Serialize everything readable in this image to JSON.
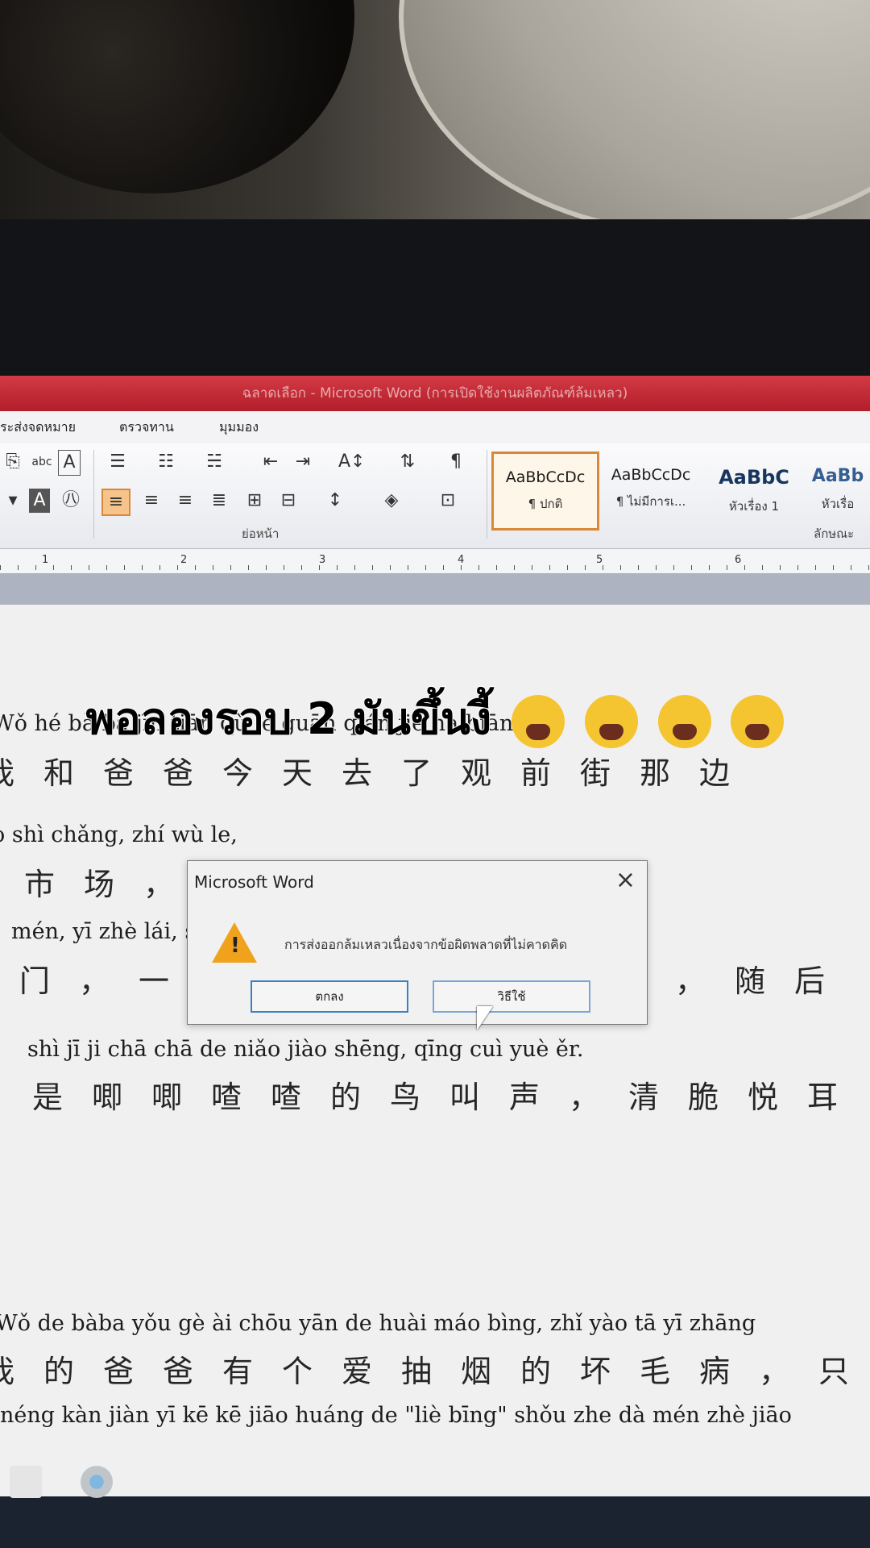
{
  "window": {
    "title": "ฉลาดเลือก - Microsoft Word (การเปิดใช้งานผลิตภัณฑ์ล้มเหลว)"
  },
  "ribbon": {
    "tabs": [
      "ระส่งจดหมาย",
      "ตรวจทาน",
      "มุมมอง"
    ],
    "group_paragraph": "ย่อหน้า",
    "group_styles": "ลักษณะ",
    "styles": [
      {
        "sample": "AaBbCcDc",
        "name": "¶ ปกติ"
      },
      {
        "sample": "AaBbCcDc",
        "name": "¶ ไม่มีการเ..."
      },
      {
        "sample": "AaBbC",
        "name": "หัวเรื่อง 1"
      },
      {
        "sample": "AaBb",
        "name": "หัวเรื่อ"
      }
    ]
  },
  "ruler": [
    "1",
    "2",
    "3",
    "4",
    "5",
    "6"
  ],
  "caption": "พอลองรอบ 2 มันขึ้นงี้",
  "document": {
    "lines": [
      {
        "pinyin": "Wǒ   hé    bà ba    jīn  tiān    qù    le     guān    qián     jiē      nà     biān",
        "hanzi": "我和爸爸今天去了观前街那边"
      },
      {
        "pinyin": "o   shì  chǎng,                                                              zhí   wù     le,",
        "hanzi": "市场，                     植物了，"
      },
      {
        "pinyin": "mén,  yī   zhè                                                            lái,    suí    hòu  g",
        "hanzi": "门，一阵花香就扑面而来，随后"
      },
      {
        "pinyin": "shì     jī    ji    chā  chā    de  niǎo  jiào  shēng, qīng  cuì    yuè    ěr.",
        "hanzi": "是唧唧喳喳的鸟叫声，清脆悦耳"
      },
      {
        "pinyin": "Wǒ  de   bàba   yǒu   gè    ài  chōu yān  de   huài máo bìng, zhǐ yào   tā  yī  zhāng",
        "hanzi": "我的爸爸有个爱抽烟的坏毛病，只要他一张"
      },
      {
        "pinyin": "néng kàn jiàn yī    kē   kē  jiāo huáng de     \"liè  bīng\" shǒu  zhe dà   mén   zhè jiāo",
        "hanzi": ""
      }
    ]
  },
  "dialog": {
    "title": "Microsoft Word",
    "close": "×",
    "message": "การส่งออกล้มเหลวเนื่องจากข้อผิดพลาดที่ไม่คาดคิด",
    "ok_label": "ตกลง",
    "help_label": "วิธีใช้"
  },
  "colors": {
    "titlebar": "#c0262f",
    "dialog_button_border": "#3b7fc4",
    "active_button": "#f6c38a"
  }
}
